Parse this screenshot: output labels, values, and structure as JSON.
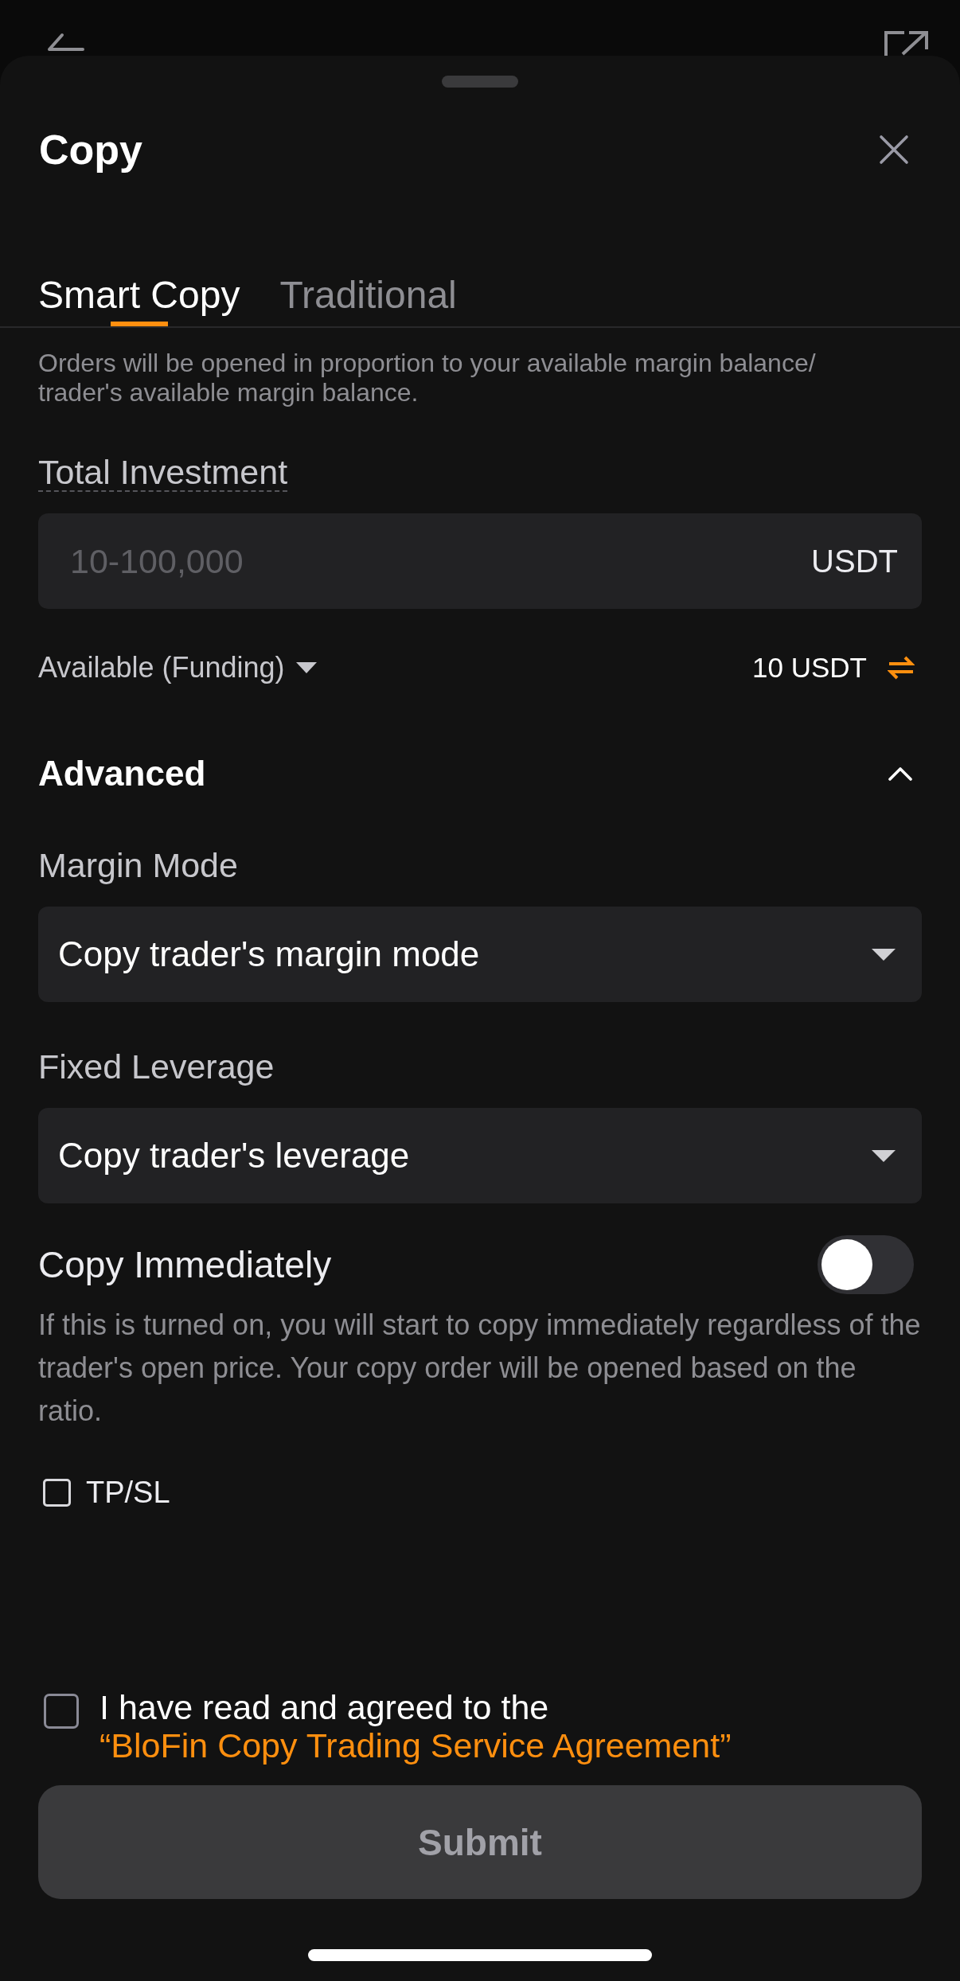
{
  "sheet": {
    "title": "Copy"
  },
  "tabs": [
    {
      "label": "Smart Copy",
      "selected": true
    },
    {
      "label": "Traditional",
      "selected": false
    }
  ],
  "mode_description": "Orders will be opened in proportion to your available margin balance/ trader's available margin balance.",
  "investment": {
    "label": "Total Investment",
    "placeholder": "10-100,000",
    "unit": "USDT"
  },
  "available": {
    "label": "Available (Funding)",
    "amount": "10 USDT"
  },
  "advanced": {
    "title": "Advanced",
    "expanded": true,
    "fields": [
      {
        "label": "Margin Mode",
        "value": "Copy trader's margin mode"
      },
      {
        "label": "Fixed Leverage",
        "value": "Copy trader's leverage"
      }
    ],
    "copy_immediately": {
      "label": "Copy Immediately",
      "on": false,
      "description": "If this is turned on, you will start to copy immediately regardless of the trader's open price. Your copy order will be opened based on the ratio."
    },
    "tpsl": {
      "label": "TP/SL",
      "checked": false
    }
  },
  "agreement": {
    "text": "I have read and agreed to the",
    "link": "“BloFin Copy Trading Service Agreement”",
    "checked": false
  },
  "submit": {
    "label": "Submit",
    "disabled": true
  }
}
